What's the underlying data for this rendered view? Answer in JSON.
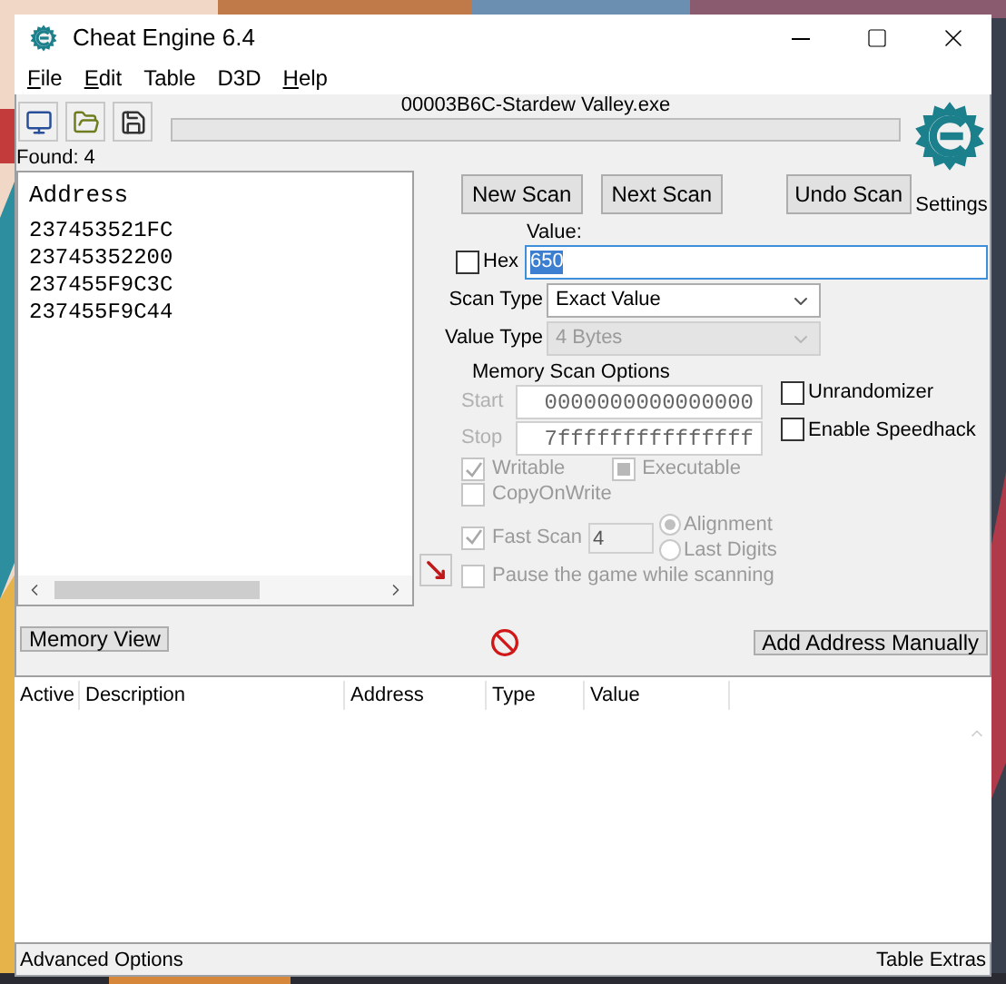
{
  "window": {
    "title": "Cheat Engine 6.4"
  },
  "menu": [
    {
      "label": "File",
      "underline": true
    },
    {
      "label": "Edit",
      "underline": true
    },
    {
      "label": "Table",
      "underline": false
    },
    {
      "label": "D3D",
      "underline": false
    },
    {
      "label": "Help",
      "underline": true
    }
  ],
  "process": "00003B6C-Stardew Valley.exe",
  "progress": {
    "level": 0
  },
  "found": "Found: 4",
  "address_list": {
    "column": "Address",
    "rows": [
      "237453521FC",
      "23745352200",
      "237455F9C3C",
      "237455F9C44"
    ]
  },
  "scan_buttons": [
    {
      "label": "New Scan"
    },
    {
      "label": "Next Scan"
    }
  ],
  "undo_button": "Undo Scan",
  "logo_label": "Settings",
  "value": {
    "label": "Value:",
    "value": "650",
    "hex": {
      "label": "Hex",
      "checked": false
    }
  },
  "scan_type": {
    "label": "Scan Type",
    "value": "Exact Value",
    "disabled": false
  },
  "value_type": {
    "label": "Value Type",
    "value": "4 Bytes",
    "disabled": true
  },
  "memory_scan_options": {
    "title": "Memory Scan Options",
    "disabled": true,
    "start": {
      "label": "Start",
      "value": "0000000000000000"
    },
    "stop": {
      "label": "Stop",
      "value": "7fffffffffffffff"
    },
    "writable": {
      "label": "Writable",
      "checked": true
    },
    "executable": {
      "label": "Executable",
      "checked": false,
      "mixed": true
    },
    "copy_on_write": {
      "label": "CopyOnWrite",
      "checked": false
    },
    "fast_scan": {
      "label": "Fast Scan",
      "checked": true,
      "value": "4"
    },
    "alignment": [
      {
        "label": "Alignment",
        "selected": true
      },
      {
        "label": "Last Digits",
        "selected": false
      }
    ],
    "pause": {
      "label": "Pause the game while scanning",
      "checked": false
    }
  },
  "extra_options": [
    {
      "label": "Unrandomizer",
      "checked": false
    },
    {
      "label": "Enable Speedhack",
      "checked": false
    }
  ],
  "memory_view_button": "Memory View",
  "add_address_button": "Add Address Manually",
  "table": {
    "columns": [
      "Active",
      "Description",
      "Address",
      "Type",
      "Value"
    ]
  },
  "footer": {
    "left": "Advanced Options",
    "right": "Table Extras"
  }
}
